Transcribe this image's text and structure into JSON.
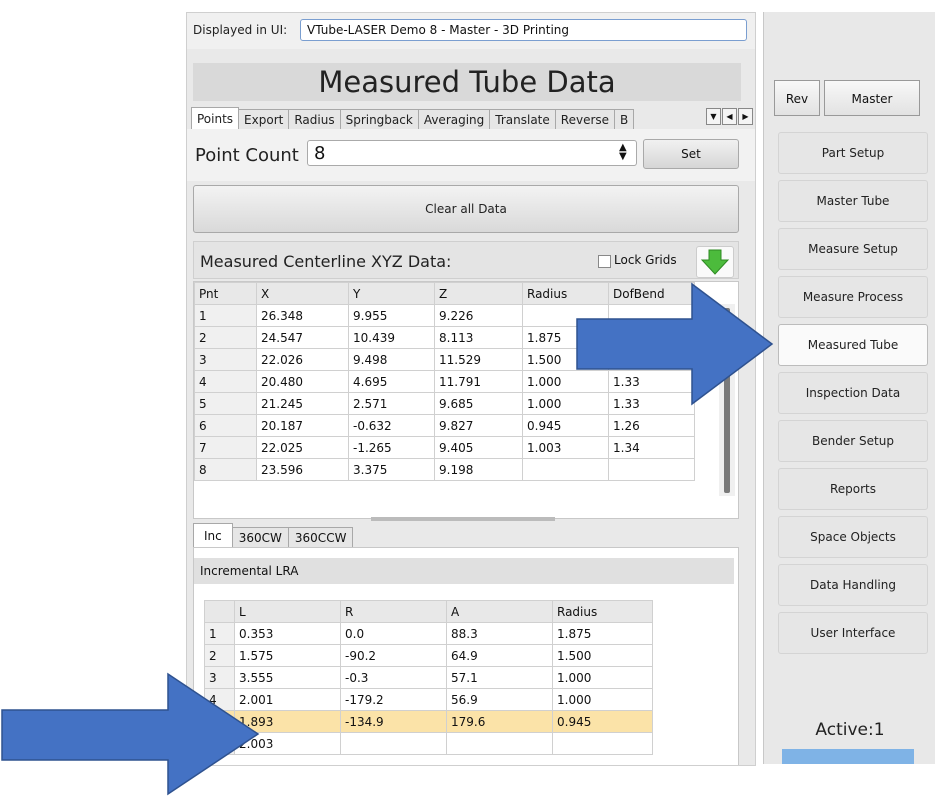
{
  "display_bar": {
    "label": "Displayed in UI:",
    "value": "VTube-LASER Demo 8 - Master - 3D Printing"
  },
  "title": "Measured Tube Data",
  "tabs": [
    "Points",
    "Export",
    "Radius",
    "Springback",
    "Averaging",
    "Translate",
    "Reverse",
    "B"
  ],
  "point_count": {
    "label": "Point Count",
    "value": "8",
    "set_label": "Set"
  },
  "clear_label": "Clear all Data",
  "centerline": {
    "title": "Measured Centerline XYZ Data:",
    "lock_grids": "Lock Grids",
    "headers": [
      "Pnt",
      "X",
      "Y",
      "Z",
      "Radius",
      "DofBend"
    ],
    "rows": [
      [
        "1",
        "26.348",
        "9.955",
        "9.226",
        "",
        ""
      ],
      [
        "2",
        "24.547",
        "10.439",
        "8.113",
        "1.875",
        ""
      ],
      [
        "3",
        "22.026",
        "9.498",
        "11.529",
        "1.500",
        ""
      ],
      [
        "4",
        "20.480",
        "4.695",
        "11.791",
        "1.000",
        "1.33"
      ],
      [
        "5",
        "21.245",
        "2.571",
        "9.685",
        "1.000",
        "1.33"
      ],
      [
        "6",
        "20.187",
        "-0.632",
        "9.827",
        "0.945",
        "1.26"
      ],
      [
        "7",
        "22.025",
        "-1.265",
        "9.405",
        "1.003",
        "1.34"
      ],
      [
        "8",
        "23.596",
        "3.375",
        "9.198",
        "",
        ""
      ]
    ]
  },
  "lra": {
    "tabs": [
      "Inc",
      "360CW",
      "360CCW"
    ],
    "label": "Incremental LRA",
    "headers": [
      "",
      "L",
      "R",
      "A",
      "Radius"
    ],
    "rows": [
      [
        "1",
        "0.353",
        "0.0",
        "88.3",
        "1.875"
      ],
      [
        "2",
        "1.575",
        "-90.2",
        "64.9",
        "1.500"
      ],
      [
        "3",
        "3.555",
        "-0.3",
        "57.1",
        "1.000"
      ],
      [
        "4",
        "2.001",
        "-179.2",
        "56.9",
        "1.000"
      ],
      [
        "",
        "1.893",
        "-134.9",
        "179.6",
        "0.945"
      ],
      [
        "",
        "2.003",
        "",
        "",
        ""
      ]
    ]
  },
  "sidebar": {
    "rev": "Rev",
    "master": "Master",
    "items": [
      "Part Setup",
      "Master Tube",
      "Measure Setup",
      "Measure Process",
      "Measured Tube",
      "Inspection Data",
      "Bender Setup",
      "Reports",
      "Space Objects",
      "Data Handling",
      "User Interface"
    ],
    "active_item": "Measured Tube",
    "active_label": "Active:1"
  },
  "colors": {
    "highlight_row": "#fbe3a8",
    "annotation_arrow": "#4472c4",
    "green_arrow": "#4cbb3c"
  }
}
